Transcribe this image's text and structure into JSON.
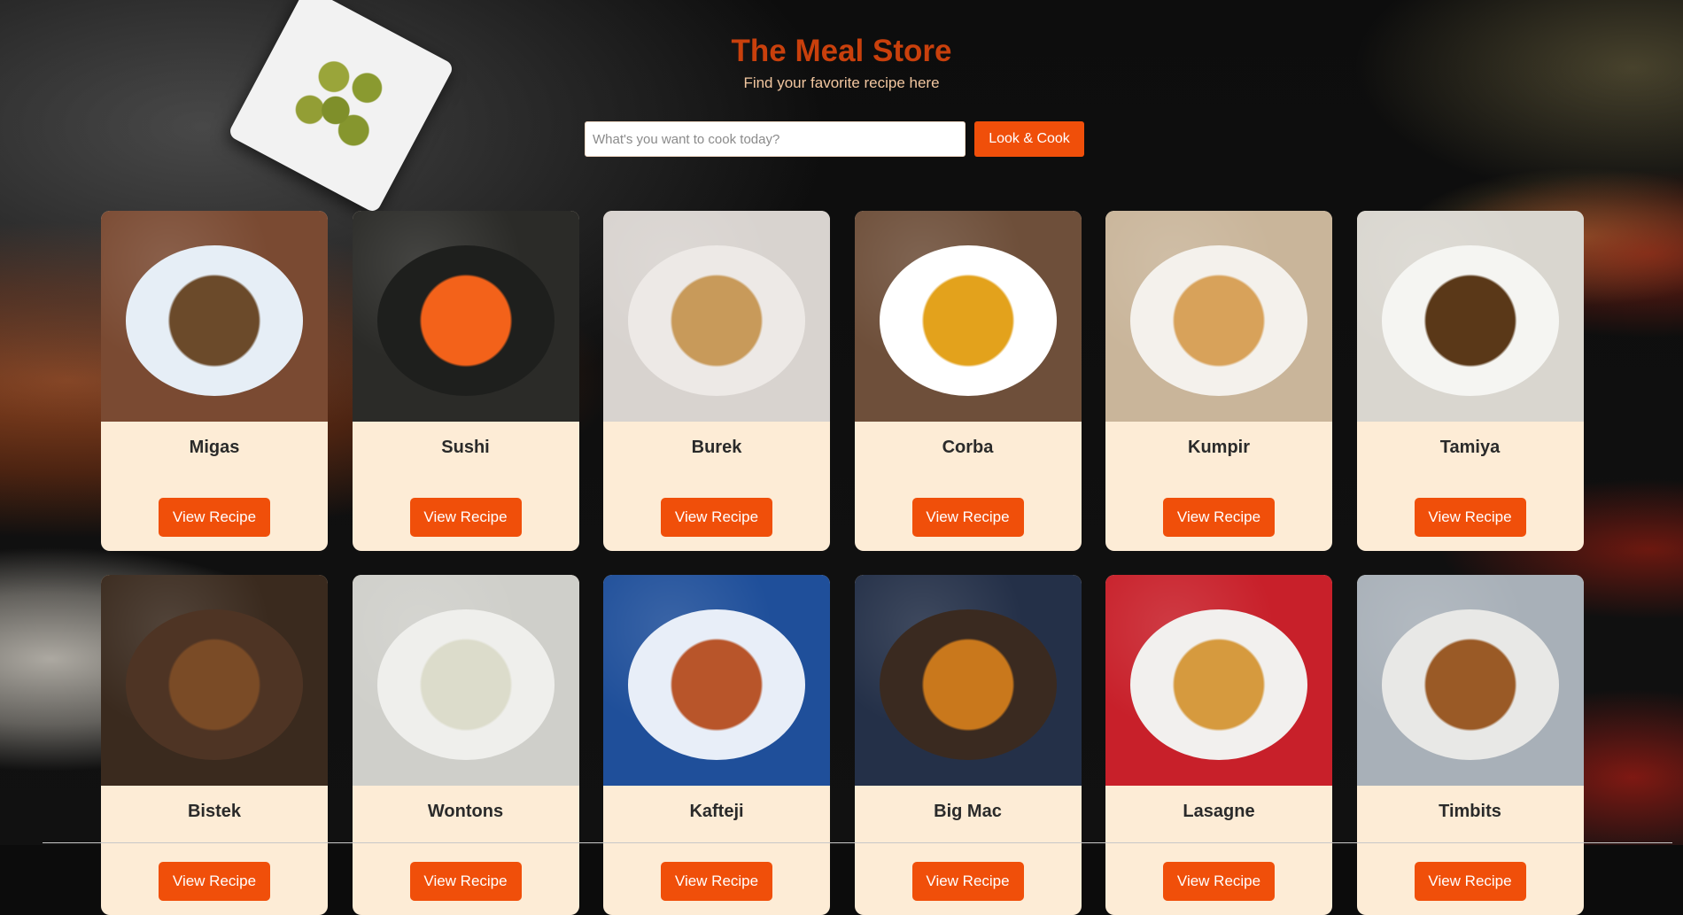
{
  "header": {
    "title": "The Meal Store",
    "subtitle": "Find your favorite recipe here"
  },
  "search": {
    "placeholder": "What's you want to cook today?",
    "value": "",
    "button_label": "Look & Cook"
  },
  "meals": [
    {
      "name": "Migas",
      "button": "View Recipe",
      "bg": "#7a4a32",
      "plate": "#e6eef6",
      "food": "#6b4a2a"
    },
    {
      "name": "Sushi",
      "button": "View Recipe",
      "bg": "#2b2b28",
      "plate": "#1e1f1d",
      "food": "#f3621a"
    },
    {
      "name": "Burek",
      "button": "View Recipe",
      "bg": "#d8d3cf",
      "plate": "#ede9e6",
      "food": "#c89a5a"
    },
    {
      "name": "Corba",
      "button": "View Recipe",
      "bg": "#6e4f3a",
      "plate": "#ffffff",
      "food": "#e3a21c"
    },
    {
      "name": "Kumpir",
      "button": "View Recipe",
      "bg": "#c9b59a",
      "plate": "#f4f1ec",
      "food": "#d8a25a"
    },
    {
      "name": "Tamiya",
      "button": "View Recipe",
      "bg": "#d9d6cf",
      "plate": "#f5f5f2",
      "food": "#5a3818"
    },
    {
      "name": "Bistek",
      "button": "View Recipe",
      "bg": "#3a2a1e",
      "plate": "#4e3424",
      "food": "#7a4b26"
    },
    {
      "name": "Wontons",
      "button": "View Recipe",
      "bg": "#cfcfca",
      "plate": "#efefec",
      "food": "#dcdccb"
    },
    {
      "name": "Kafteji",
      "button": "View Recipe",
      "bg": "#1f4f9a",
      "plate": "#e8eef8",
      "food": "#b8552a"
    },
    {
      "name": "Big Mac",
      "button": "View Recipe",
      "bg": "#243048",
      "plate": "#3a2a20",
      "food": "#c9781c"
    },
    {
      "name": "Lasagne",
      "button": "View Recipe",
      "bg": "#c8202a",
      "plate": "#f2f0ee",
      "food": "#d69a3e"
    },
    {
      "name": "Timbits",
      "button": "View Recipe",
      "bg": "#a8b0b8",
      "plate": "#e8e8e6",
      "food": "#9a5a26"
    }
  ]
}
